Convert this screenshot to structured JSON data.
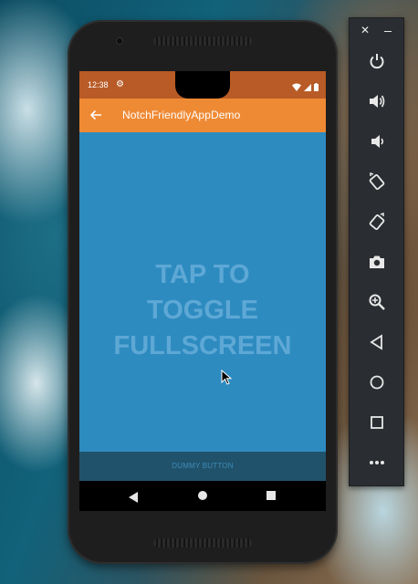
{
  "status_bar": {
    "time": "12:38"
  },
  "app_bar": {
    "title": "NotchFriendlyAppDemo"
  },
  "content": {
    "fullscreen_text": "TAP TO\nTOGGLE\nFULLSCREEN"
  },
  "dummy": {
    "button_label": "DUMMY BUTTON"
  },
  "toolbar": {
    "close_label": "✕",
    "buttons": [
      "power",
      "volume-up",
      "volume-down",
      "rotate-left",
      "rotate-right",
      "screenshot",
      "zoom",
      "back",
      "home",
      "overview",
      "more"
    ]
  },
  "colors": {
    "status_bar": "#b85b26",
    "app_bar": "#ef8a34",
    "content": "#2e8bc0",
    "dummy_bar": "#21526b"
  }
}
